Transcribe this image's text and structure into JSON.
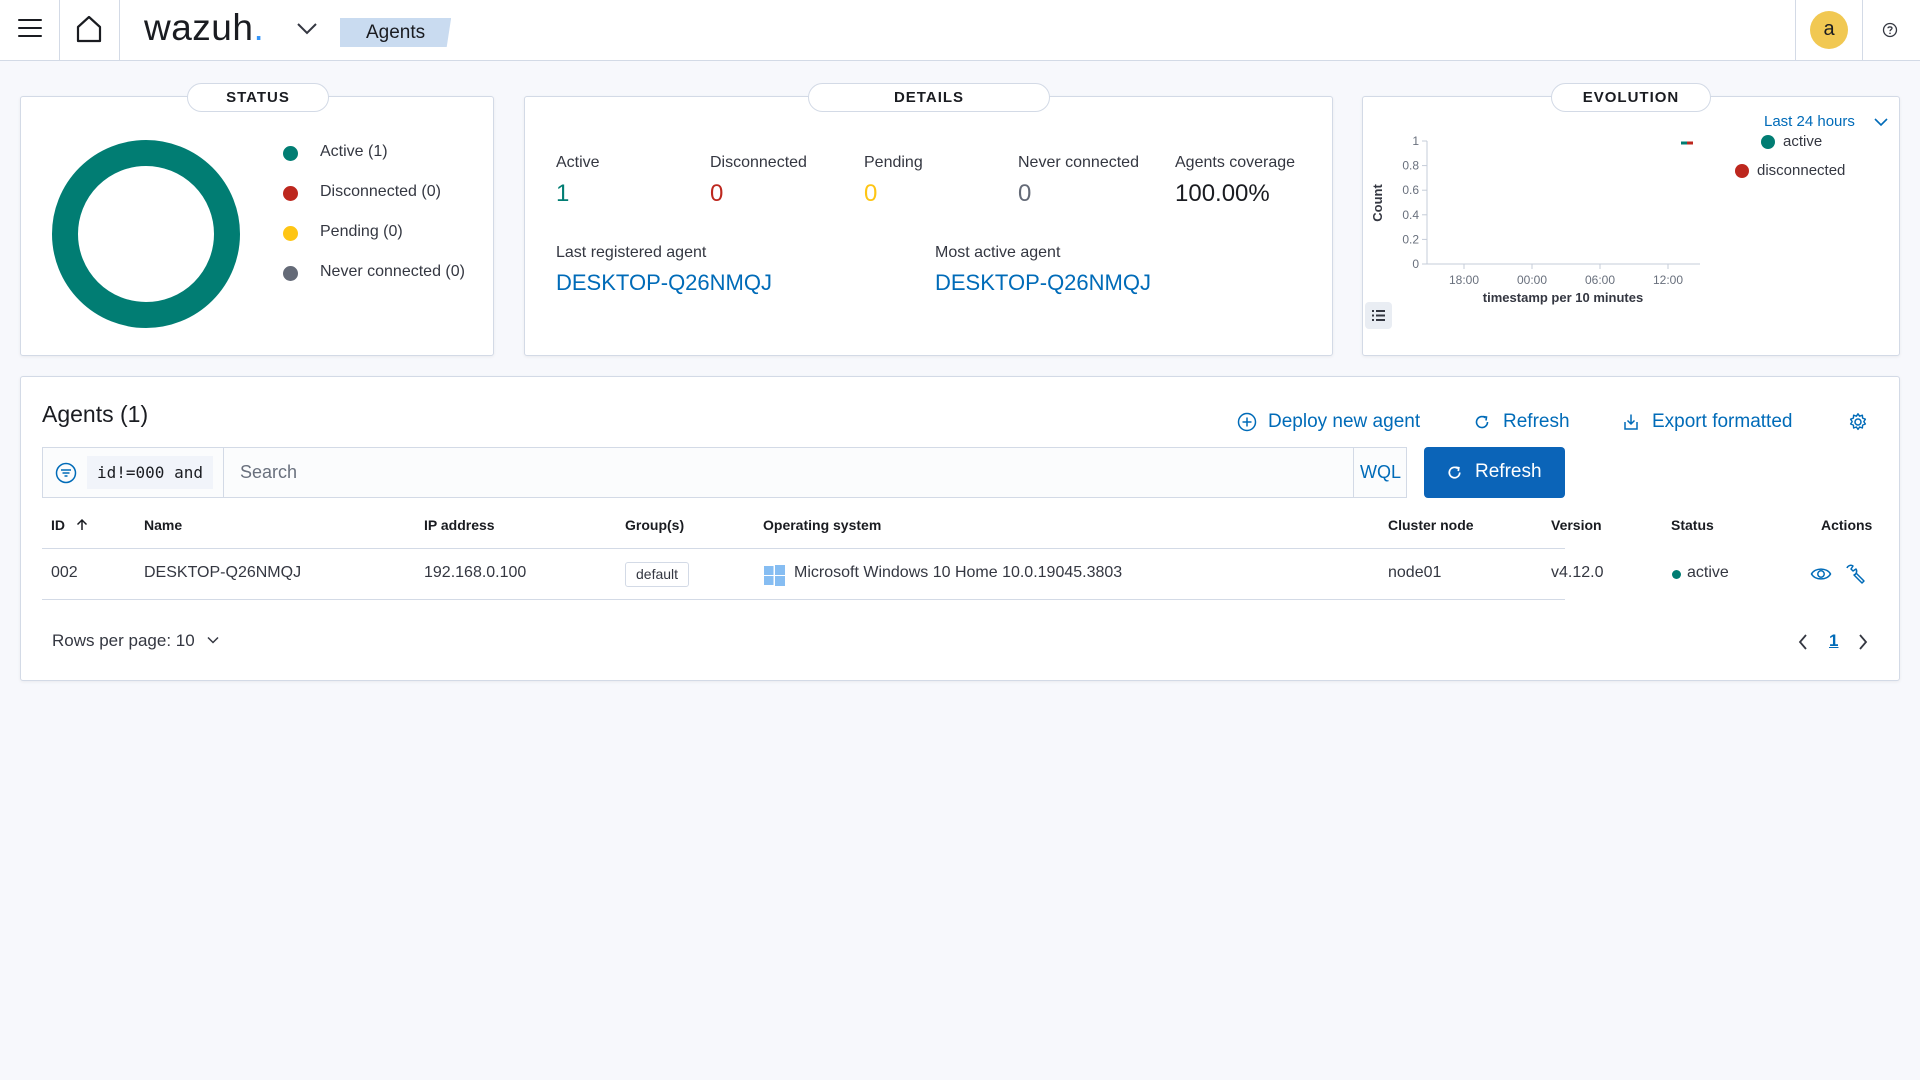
{
  "header": {
    "logo_text": "wazuh",
    "logo_dot": ".",
    "breadcrumb": "Agents",
    "avatar_letter": "a"
  },
  "status_panel": {
    "title": "STATUS",
    "legend": [
      {
        "label": "Active (1)",
        "color": "#017d73"
      },
      {
        "label": "Disconnected (0)",
        "color": "#bd271e"
      },
      {
        "label": "Pending (0)",
        "color": "#fec514"
      },
      {
        "label": "Never connected (0)",
        "color": "#646a77"
      }
    ],
    "donut_color": "#017d73"
  },
  "details_panel": {
    "title": "DETAILS",
    "stats": [
      {
        "label": "Active",
        "value": "1",
        "color": "#017d73"
      },
      {
        "label": "Disconnected",
        "value": "0",
        "color": "#bd271e"
      },
      {
        "label": "Pending",
        "value": "0",
        "color": "#fec514"
      },
      {
        "label": "Never connected",
        "value": "0",
        "color": "#646a77"
      },
      {
        "label": "Agents coverage",
        "value": "100.00%",
        "color": "#1a1c21"
      }
    ],
    "last_registered_label": "Last registered agent",
    "last_registered_value": "DESKTOP-Q26NMQJ",
    "most_active_label": "Most active agent",
    "most_active_value": "DESKTOP-Q26NMQJ"
  },
  "evolution_panel": {
    "title": "EVOLUTION",
    "range": "Last 24 hours",
    "legend": [
      {
        "label": "active",
        "color": "#017d73"
      },
      {
        "label": "disconnected",
        "color": "#bd271e"
      }
    ],
    "chart_data": {
      "type": "line",
      "ylabel": "Count",
      "xlabel": "timestamp per 10 minutes",
      "y_ticks": [
        "0",
        "0.2",
        "0.4",
        "0.6",
        "0.8",
        "1"
      ],
      "x_ticks": [
        "18:00",
        "00:00",
        "06:00",
        "12:00"
      ],
      "ylim": [
        0,
        1
      ],
      "series": [
        {
          "name": "active",
          "values": [
            1
          ]
        },
        {
          "name": "disconnected",
          "values": [
            1
          ]
        }
      ]
    }
  },
  "agents": {
    "title": "Agents (1)",
    "deploy_label": "Deploy new agent",
    "refresh_label": "Refresh",
    "export_label": "Export formatted",
    "query_chip": "id!=000 and",
    "search_placeholder": "Search",
    "wql_label": "WQL",
    "refresh_button": "Refresh",
    "columns": [
      "ID",
      "Name",
      "IP address",
      "Group(s)",
      "Operating system",
      "Cluster node",
      "Version",
      "Status",
      "Actions"
    ],
    "rows": [
      {
        "id": "002",
        "name": "DESKTOP-Q26NMQJ",
        "ip": "192.168.0.100",
        "group": "default",
        "os": "Microsoft Windows 10 Home 10.0.19045.3803",
        "cluster_node": "node01",
        "version": "v4.12.0",
        "status": "active",
        "status_color": "#017d73"
      }
    ],
    "rows_per_page": "Rows per page: 10",
    "current_page": "1"
  }
}
